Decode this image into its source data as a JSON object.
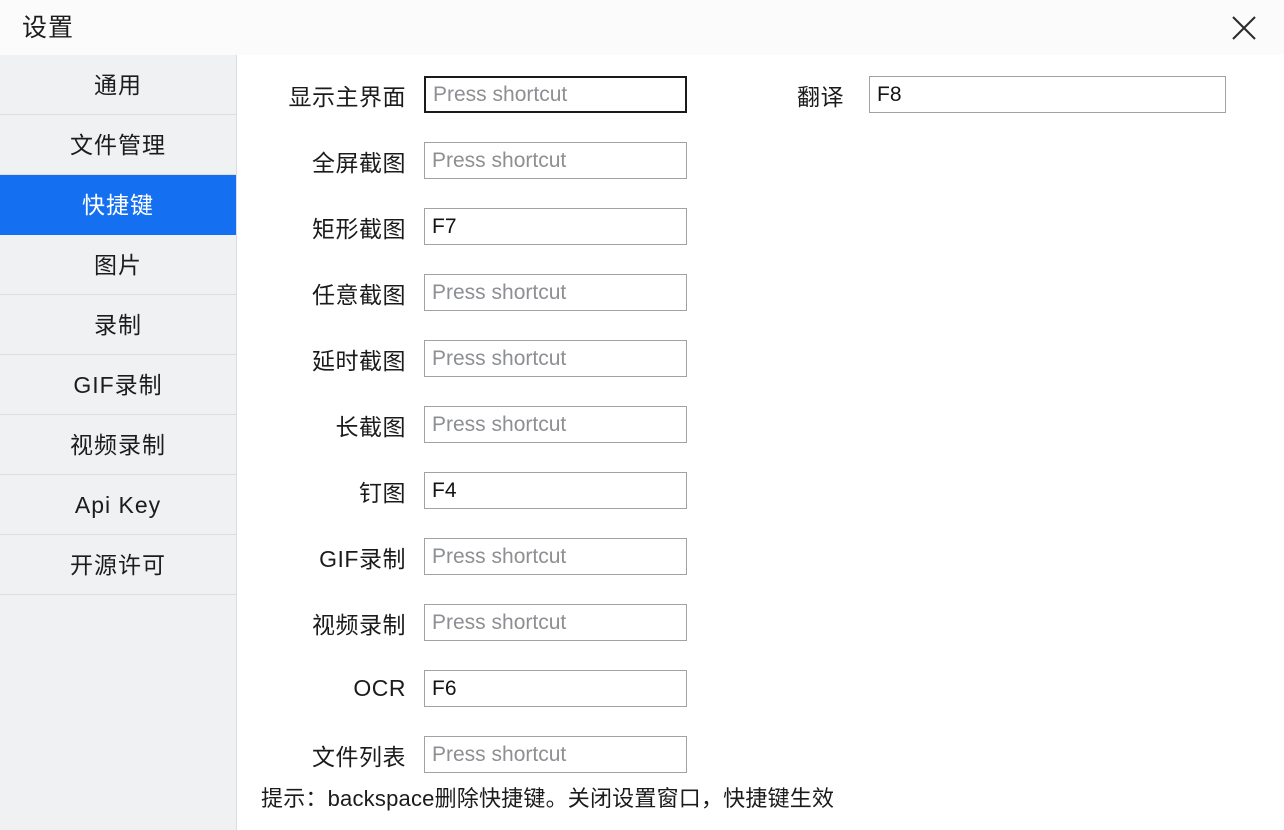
{
  "window": {
    "title": "设置",
    "close_icon": "close-icon"
  },
  "sidebar": {
    "items": [
      {
        "label": "通用",
        "active": false
      },
      {
        "label": "文件管理",
        "active": false
      },
      {
        "label": "快捷键",
        "active": true
      },
      {
        "label": "图片",
        "active": false
      },
      {
        "label": "录制",
        "active": false
      },
      {
        "label": "GIF录制",
        "active": false
      },
      {
        "label": "视频录制",
        "active": false
      },
      {
        "label": "Api Key",
        "active": false
      },
      {
        "label": "开源许可",
        "active": false
      }
    ],
    "active_color": "#1470f0",
    "background": "#f0f1f3"
  },
  "main": {
    "placeholder": "Press shortcut",
    "shortcuts": [
      {
        "label": "显示主界面",
        "value": "",
        "focused": true
      },
      {
        "label": "全屏截图",
        "value": "",
        "focused": false
      },
      {
        "label": "矩形截图",
        "value": "F7",
        "focused": false
      },
      {
        "label": "任意截图",
        "value": "",
        "focused": false
      },
      {
        "label": "延时截图",
        "value": "",
        "focused": false
      },
      {
        "label": "长截图",
        "value": "",
        "focused": false
      },
      {
        "label": "钉图",
        "value": "F4",
        "focused": false
      },
      {
        "label": "GIF录制",
        "value": "",
        "focused": false
      },
      {
        "label": "视频录制",
        "value": "",
        "focused": false
      },
      {
        "label": "OCR",
        "value": "F6",
        "focused": false
      },
      {
        "label": "文件列表",
        "value": "",
        "focused": false
      }
    ],
    "translate": {
      "label": "翻译",
      "value": "F8",
      "focused": false
    },
    "hint": "提示：backspace删除快捷键。关闭设置窗口，快捷键生效"
  }
}
